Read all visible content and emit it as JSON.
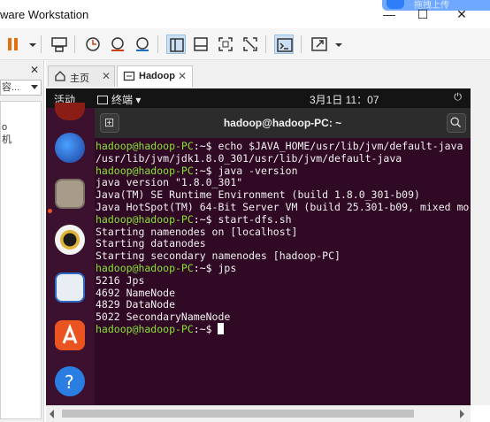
{
  "window": {
    "title": "ware Workstation",
    "minimize": "—",
    "maximize": "☐",
    "close": "✕",
    "cloud_text": "拖拽上传"
  },
  "toolbar": {
    "icons": [
      "pause-icon",
      "dropdown-icon",
      "send-keys-icon",
      "snapshot-icon",
      "revert-snapshot-icon",
      "snapshot-manager-icon",
      "show-library-icon",
      "thumbnail-icon",
      "fullscreen-icon",
      "unity-icon",
      "console-icon",
      "stretch-icon",
      "dropdown-icon"
    ]
  },
  "sidebar": {
    "close": "✕",
    "combo_value": "容...",
    "tree_items": [
      "o",
      "机"
    ]
  },
  "tabs": [
    {
      "label": "主页",
      "icon": "home-icon"
    },
    {
      "label": "Hadoop",
      "icon": "vm-icon"
    }
  ],
  "vm": {
    "gnome_bar": {
      "activities": "活动",
      "app": "终端",
      "clock": "3月1日  11：07",
      "status_icons": "⏻"
    },
    "terminal": {
      "title": "hadoop@hadoop-PC: ~",
      "prompt_user": "hadoop@hadoop-PC",
      "prompt_path": ":~$ ",
      "lines": [
        {
          "type": "cmd",
          "text": "echo $JAVA_HOME/usr/lib/jvm/default-java"
        },
        {
          "type": "out",
          "text": "/usr/lib/jvm/jdk1.8.0_301/usr/lib/jvm/default-java"
        },
        {
          "type": "cmd",
          "text": "java -version"
        },
        {
          "type": "out",
          "text": "java version \"1.8.0_301\""
        },
        {
          "type": "out",
          "text": "Java(TM) SE Runtime Environment (build 1.8.0_301-b09)"
        },
        {
          "type": "out",
          "text": "Java HotSpot(TM) 64-Bit Server VM (build 25.301-b09, mixed mo"
        },
        {
          "type": "cmd",
          "text": "start-dfs.sh"
        },
        {
          "type": "out",
          "text": "Starting namenodes on [localhost]"
        },
        {
          "type": "out",
          "text": "Starting datanodes"
        },
        {
          "type": "out",
          "text": "Starting secondary namenodes [hadoop-PC]"
        },
        {
          "type": "cmd",
          "text": "jps"
        },
        {
          "type": "out",
          "text": "5216 Jps"
        },
        {
          "type": "out",
          "text": "4692 NameNode"
        },
        {
          "type": "out",
          "text": "4829 DataNode"
        },
        {
          "type": "out",
          "text": "5022 SecondaryNameNode"
        },
        {
          "type": "cmd",
          "text": ""
        }
      ]
    },
    "dock_icons": [
      "app-icon",
      "thunderbird-icon",
      "files-icon",
      "rhythmbox-icon",
      "writer-icon",
      "software-icon",
      "help-icon"
    ]
  },
  "colors": {
    "terminal_bg": "#300a24",
    "prompt_green": "#8ae234",
    "dock_bg": "#3c1130",
    "ubuntu_orange": "#e95420"
  }
}
